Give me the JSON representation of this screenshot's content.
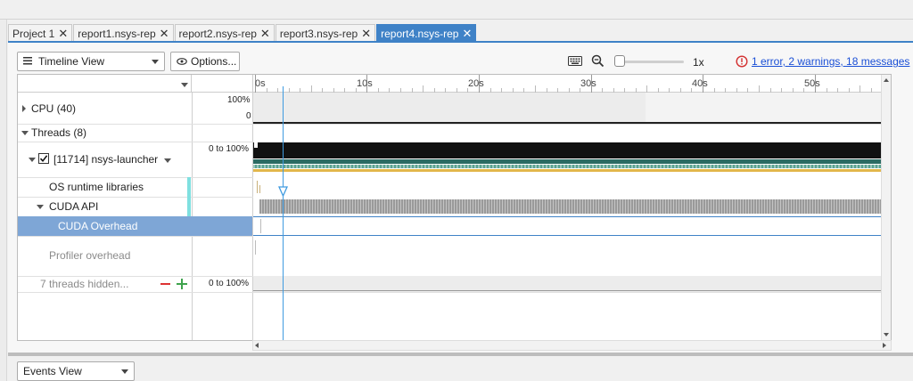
{
  "tabs": [
    {
      "label": "Project 1",
      "active": false
    },
    {
      "label": "report1.nsys-rep",
      "active": false
    },
    {
      "label": "report2.nsys-rep",
      "active": false
    },
    {
      "label": "report3.nsys-rep",
      "active": false
    },
    {
      "label": "report4.nsys-rep",
      "active": true
    }
  ],
  "toolbar": {
    "view_select": "Timeline View",
    "options_label": "Options...",
    "zoom_level": "1x",
    "diagnostics": "1 error, 2 warnings, 18 messages"
  },
  "ruler": {
    "ticks": [
      "0s",
      "10s",
      "20s",
      "30s",
      "40s",
      "50s"
    ]
  },
  "rows": {
    "cpu_label": "CPU (40)",
    "cpu_scale_top": "100%",
    "cpu_scale_bottom": "0",
    "threads_label": "Threads (8)",
    "process_label": "[11714] nsys-launcher",
    "process_scale": "0 to 100%",
    "os_runtime": "OS runtime libraries",
    "cuda_api": "CUDA API",
    "cuda_overhead": "CUDA Overhead",
    "profiler_overhead": "Profiler overhead",
    "hidden_threads": "7 threads hidden...",
    "hidden_scale": "0 to 100%"
  },
  "bottom": {
    "events_view": "Events View"
  },
  "colors": {
    "accent": "#3f82c7",
    "selected_row": "#7ea6d6",
    "error": "#d32f2f",
    "link": "#1a4fd6"
  }
}
